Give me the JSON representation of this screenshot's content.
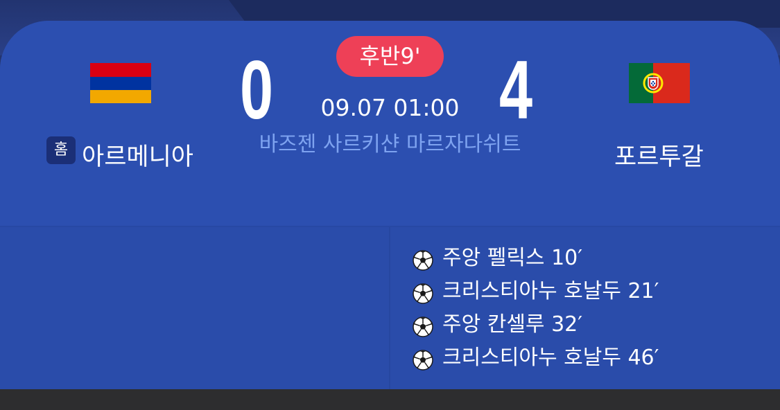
{
  "match": {
    "status": "후반9'",
    "datetime": "09.07 01:00",
    "venue": "바즈젠 사르키샨 마르자다쉬트"
  },
  "home": {
    "badge": "홈",
    "name": "아르메니아",
    "score": "0",
    "flag_colors": [
      "#d90012",
      "#0033a0",
      "#f2a800"
    ]
  },
  "away": {
    "name": "포르투갈",
    "score": "4",
    "flag_colors": [
      "#046a38",
      "#da291c",
      "#ffe900"
    ]
  },
  "goals": [
    {
      "icon": "soccer-ball-icon",
      "text": "주앙 펠릭스 10′"
    },
    {
      "icon": "soccer-ball-icon",
      "text": "크리스티아누 호날두 21′"
    },
    {
      "icon": "soccer-ball-icon",
      "text": "주앙 칸셀루 32′"
    },
    {
      "icon": "soccer-ball-icon",
      "text": "크리스티아누 호날두 46′"
    }
  ],
  "colors": {
    "card_bg": "#2c4fb0",
    "status_pill": "#ee4057",
    "venue_text": "#7ea3f0"
  }
}
